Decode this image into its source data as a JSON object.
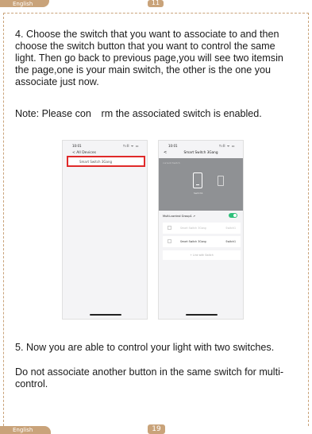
{
  "header": {
    "language": "English",
    "page_number": "11"
  },
  "footer": {
    "language": "English",
    "page_number": "19"
  },
  "content": {
    "step4": "4. Choose the switch that you want to associate to and then choose the switch button that you want to control the same light. Then go back to previous page,you will see two itemsin the page,one is your main switch, the other is the one you associate just now.",
    "note": "Note: Please con  rm the associated switch is enabled.",
    "step5": "5. Now you are able to control your light with two switches.",
    "step5_extra": "Do not associate another button in the same switch for multi-control."
  },
  "phone1": {
    "time": "10:01",
    "signal": "↑ıll ᯤ ▭",
    "back_label": "< All Devices",
    "device": "Smart Switch 3Gang"
  },
  "phone2": {
    "time": "10:01",
    "signal": "↑ıll ᯤ ▭",
    "back": "<",
    "title": "Smart Switch 3Gang",
    "current": "current Switch",
    "switch_label": "Switch1",
    "multi_control": "Multi-control Group1 ↗",
    "rows": [
      {
        "name": "Smart Switch 3Gang",
        "switch": "Switch1"
      },
      {
        "name": "Smart Switch 3Gang",
        "switch": "Switch1"
      }
    ],
    "add_button": "+ Link with Switch"
  }
}
